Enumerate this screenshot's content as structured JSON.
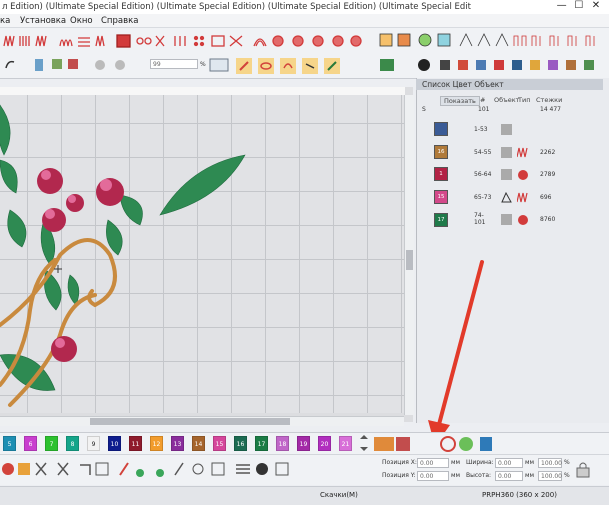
{
  "window": {
    "title": "л Edition) (Ultimate Special Edition) (Ultimate Special Edition) (Ultimate Special Edition) (Ultimate Special Edit",
    "controls": [
      "—",
      "☐",
      "✕"
    ]
  },
  "menu": [
    "ка",
    "Установка",
    "Окно",
    "Справка"
  ],
  "toolbar2": {
    "zoom_value": "99",
    "zoom_unit": "%"
  },
  "panel": {
    "title": "Список Цвет Объект",
    "headers": {
      "button": "Показать",
      "num": "#",
      "object": "Объект",
      "type": "Тип",
      "stitches": "Стежки"
    },
    "summary": {
      "s": "S",
      "num": "101",
      "stitches": "14 477"
    },
    "rows": [
      {
        "swatch_label": "",
        "swatch_color": "#3a5b96",
        "num": "1-53",
        "stitches": ""
      },
      {
        "swatch_label": "16",
        "swatch_color": "#b07a3a",
        "num": "54-55",
        "stitches": "2262"
      },
      {
        "swatch_label": "1",
        "swatch_color": "#b22245",
        "num": "56-64",
        "stitches": "2789"
      },
      {
        "swatch_label": "15",
        "swatch_color": "#d3498a",
        "num": "65-73",
        "stitches": "696"
      },
      {
        "swatch_label": "17",
        "swatch_color": "#1f7a4a",
        "num": "74-\n101",
        "stitches": "8760"
      }
    ]
  },
  "palette": [
    {
      "label": "5",
      "color": "#1e8fb3"
    },
    {
      "label": "6",
      "color": "#c93fcf"
    },
    {
      "label": "7",
      "color": "#2cc12f"
    },
    {
      "label": "8",
      "color": "#14a58a"
    },
    {
      "label": "9",
      "color": "#f2f2f2"
    },
    {
      "label": "10",
      "color": "#0e1d8e"
    },
    {
      "label": "11",
      "color": "#8f1b2c"
    },
    {
      "label": "12",
      "color": "#f29c2c"
    },
    {
      "label": "13",
      "color": "#8a2d9c"
    },
    {
      "label": "14",
      "color": "#a5642c"
    },
    {
      "label": "15",
      "color": "#d5469b"
    },
    {
      "label": "16",
      "color": "#1c6b52"
    },
    {
      "label": "17",
      "color": "#1b7c45"
    },
    {
      "label": "18",
      "color": "#c066c8"
    },
    {
      "label": "19",
      "color": "#a32aa7"
    },
    {
      "label": "20",
      "color": "#b12ebf"
    },
    {
      "label": "21",
      "color": "#d86fd8"
    }
  ],
  "fields": {
    "pos_x_label": "Позиция X:",
    "pos_x_value": "0.00",
    "pos_y_label": "Позиция Y:",
    "pos_y_value": "0.00",
    "width_label": "Ширина:",
    "width_value": "0.00",
    "height_label": "Высота:",
    "height_value": "0.00",
    "unit_mm": "мм",
    "pct1": "100.00",
    "pct2": "100.00",
    "pct_unit": "%"
  },
  "status": {
    "center": "Скачки(M)",
    "right": "PRPH360 (360 x 200)"
  },
  "colors": {
    "arrow": "#e23a2a",
    "leaf": "#2e8a52",
    "flower": "#b2284e",
    "stem": "#c98a3e"
  }
}
